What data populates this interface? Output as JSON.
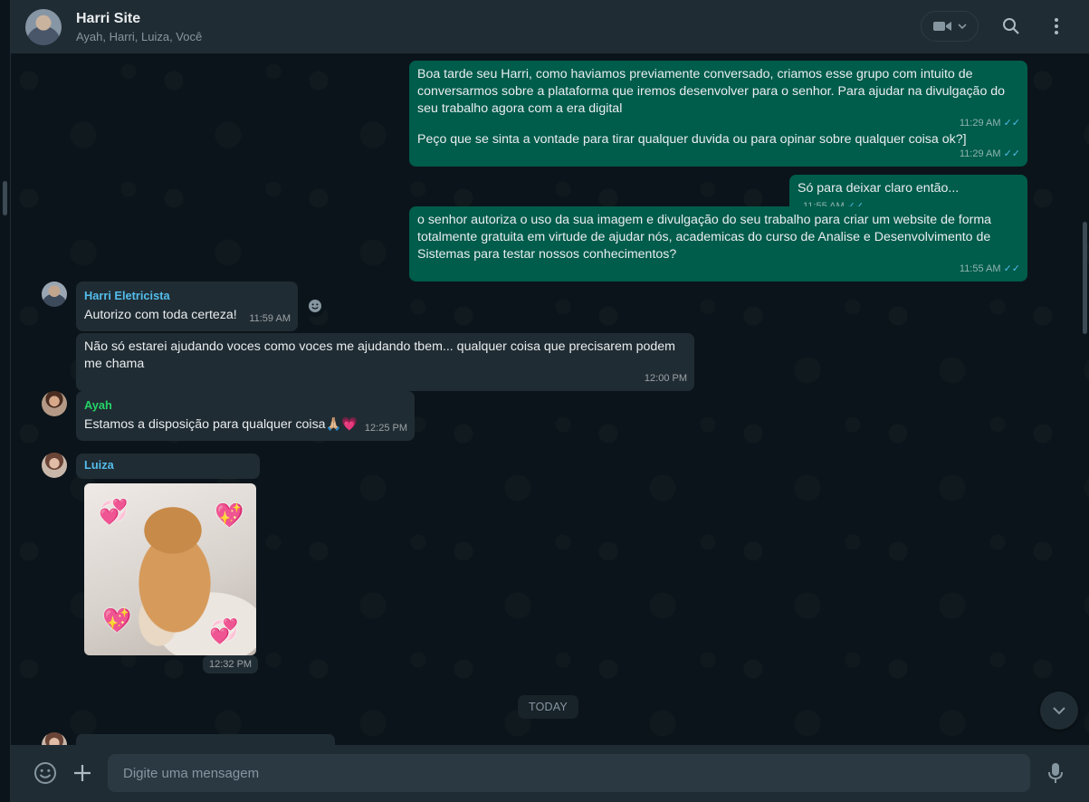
{
  "header": {
    "title": "Harri Site",
    "members": "Ayah, Harri, Luiza, Você",
    "icons": {
      "video": "video-camera-icon",
      "search": "search-icon",
      "menu": "more-vertical-icon"
    }
  },
  "messages": [
    {
      "type": "out",
      "text": "Boa tarde seu Harri, como haviamos previamente conversado, criamos esse grupo com intuito de conversarmos sobre a plataforma que iremos desenvolver para o senhor. Para ajudar na divulgação do seu trabalho agora com a era digital",
      "time": "11:29 AM"
    },
    {
      "type": "out",
      "text": "Peço que se sinta a vontade para tirar qualquer duvida ou para opinar sobre qualquer coisa ok?]",
      "time": "11:29 AM"
    },
    {
      "type": "out",
      "text": "Só para deixar claro então...",
      "time": "11:55 AM"
    },
    {
      "type": "out",
      "text": "o senhor autoriza o uso da sua imagem e divulgação do seu trabalho para criar um website de forma totalmente gratuita em virtude de ajudar nós, academicas do curso de Analise e Desenvolvimento de Sistemas para testar nossos conhecimentos?",
      "time": "11:55 AM"
    },
    {
      "type": "in",
      "sender": "Harri Eletricista",
      "text": "Autorizo com toda certeza!",
      "time": "11:59 AM"
    },
    {
      "type": "in",
      "text": "Não só estarei ajudando voces como voces me ajudando tbem...  qualquer coisa que precisarem podem me chama",
      "time": "12:00 PM"
    },
    {
      "type": "in",
      "sender": "Ayah",
      "text": "Estamos a disposição para qualquer coisa🙏🏼💗",
      "time": "12:25 PM"
    },
    {
      "type": "in",
      "sender": "Luiza",
      "sticker": "shiba-inu-hearts-sticker",
      "time": "12:32 PM"
    }
  ],
  "colors": {
    "harri_name": "#53bdeb",
    "ayah_name": "#25d366",
    "luiza_name": "#53bdeb",
    "outgoing_bubble": "#005c4b",
    "incoming_bubble": "#202c33"
  },
  "divider": {
    "today": "TODAY"
  },
  "composer": {
    "placeholder": "Digite uma mensagem",
    "icons": {
      "emoji": "emoji-icon",
      "attach": "plus-icon",
      "mic": "microphone-icon"
    }
  }
}
